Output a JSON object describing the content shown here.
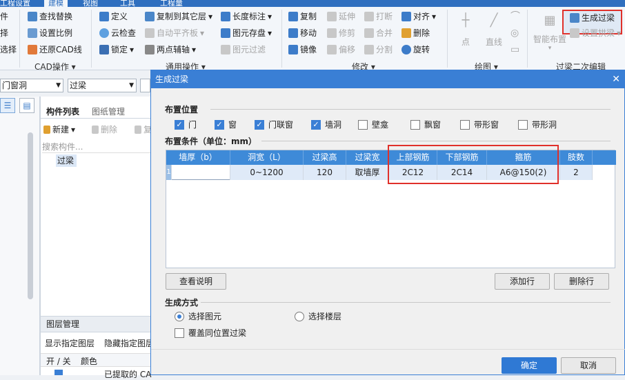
{
  "tabs": {
    "t1": "工程设置",
    "t2": "建模",
    "t3": "视图",
    "t4": "工具",
    "t5": "工程量"
  },
  "ribbon": {
    "edge": [
      "件",
      "择",
      "选择"
    ],
    "find_replace": "查找替换",
    "set_scale": "设置比例",
    "restore_cad": "还原CAD线",
    "cad_ops": "CAD操作",
    "define": "定义",
    "cloud_check": "云检查",
    "lock": "锁定",
    "copy_to_floor": "复制到其它层",
    "auto_flat": "自动平齐板",
    "two_point_axis": "两点辅轴",
    "common_ops": "通用操作",
    "length_mark": "长度标注",
    "save_element": "图元存盘",
    "element_filter": "图元过滤",
    "copy": "复制",
    "move": "移动",
    "mirror": "镜像",
    "extend": "延伸",
    "trim": "修剪",
    "offset": "偏移",
    "break": "打断",
    "merge": "合并",
    "split": "分割",
    "align": "对齐",
    "delete": "删除",
    "rotate": "旋转",
    "modify": "修改",
    "point": "点",
    "line": "直线",
    "draw": "绘图",
    "smart_layout": "智能布置",
    "generate_lintel": "生成过梁",
    "set_arch_lintel": "设置拱梁",
    "lintel_edit": "过梁二次编辑"
  },
  "combos": {
    "c1": "门窗洞",
    "c2": "过梁"
  },
  "panel": {
    "tab_list": "构件列表",
    "tab_drawing": "图纸管理",
    "new": "新建",
    "delete": "删除",
    "copy": "复",
    "search_placeholder": "搜索构件...",
    "item": "过梁",
    "layer_title": "图层管理",
    "show_layer": "显示指定图层",
    "hide_layer": "隐藏指定图层",
    "col_onoff": "开 / 关",
    "col_color": "颜色",
    "row_text": "已提取的 CA"
  },
  "dialog": {
    "title": "生成过梁",
    "section_position": "布置位置",
    "checks": [
      {
        "label": "门",
        "checked": true
      },
      {
        "label": "窗",
        "checked": true
      },
      {
        "label": "门联窗",
        "checked": true
      },
      {
        "label": "墙洞",
        "checked": true
      },
      {
        "label": "壁龛",
        "checked": false
      },
      {
        "label": "飘窗",
        "checked": false
      },
      {
        "label": "带形窗",
        "checked": false
      },
      {
        "label": "带形洞",
        "checked": false
      }
    ],
    "section_condition": "布置条件（单位：mm）",
    "columns": [
      "墙厚（b）",
      "洞宽（L）",
      "过梁高",
      "过梁宽",
      "上部钢筋",
      "下部钢筋",
      "箍筋",
      "肢数"
    ],
    "rows": [
      {
        "index": "1",
        "wall": "",
        "width": "0~1200",
        "height": "120",
        "beam_width": "取墙厚",
        "top_bar": "2C12",
        "bottom_bar": "2C14",
        "stirrup": "A6@150(2)",
        "legs": "2"
      }
    ],
    "view_help": "查看说明",
    "add_row": "添加行",
    "delete_row": "删除行",
    "section_method": "生成方式",
    "radio_element": "选择图元",
    "radio_floor": "选择楼层",
    "cover_label": "覆盖同位置过梁",
    "ok": "确定",
    "cancel": "取消"
  },
  "colors": {
    "accent": "#3a7fd5",
    "highlight": "#e0302a",
    "header": "#3e8ad8"
  }
}
